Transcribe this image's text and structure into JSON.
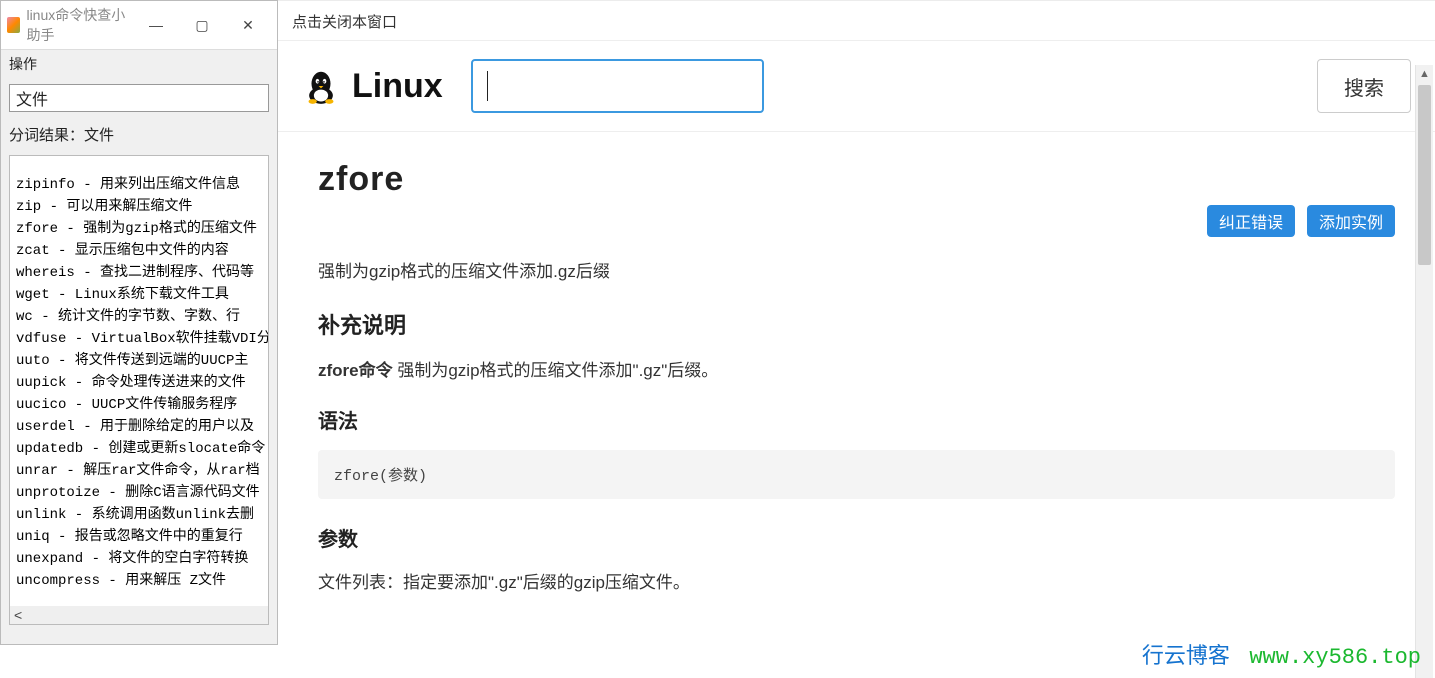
{
  "sidebar": {
    "title": "linux命令快查小助手",
    "menu_label": "操作",
    "search_value": "文件",
    "tokenize_prefix": "分词结果：",
    "tokenize_value": "文件",
    "items": [
      {
        "cmd": "zipinfo",
        "desc": "用来列出压缩文件信息"
      },
      {
        "cmd": "zip",
        "desc": "可以用来解压缩文件"
      },
      {
        "cmd": "zfore",
        "desc": "强制为gzip格式的压缩文件"
      },
      {
        "cmd": "zcat",
        "desc": "显示压缩包中文件的内容"
      },
      {
        "cmd": "whereis",
        "desc": "查找二进制程序、代码等"
      },
      {
        "cmd": "wget",
        "desc": "Linux系统下载文件工具"
      },
      {
        "cmd": "wc",
        "desc": "统计文件的字节数、字数、行"
      },
      {
        "cmd": "vdfuse",
        "desc": "VirtualBox软件挂载VDI分"
      },
      {
        "cmd": "uuto",
        "desc": "将文件传送到远端的UUCP主"
      },
      {
        "cmd": "uupick",
        "desc": "命令处理传送进来的文件"
      },
      {
        "cmd": "uucico",
        "desc": "UUCP文件传输服务程序"
      },
      {
        "cmd": "userdel",
        "desc": "用于删除给定的用户以及"
      },
      {
        "cmd": "updatedb",
        "desc": "创建或更新slocate命令"
      },
      {
        "cmd": "unrar",
        "desc": "解压rar文件命令，从rar档"
      },
      {
        "cmd": "unprotoize",
        "desc": "删除C语言源代码文件"
      },
      {
        "cmd": "unlink",
        "desc": "系统调用函数unlink去删"
      },
      {
        "cmd": "uniq",
        "desc": "报告或忽略文件中的重复行"
      },
      {
        "cmd": "unexpand",
        "desc": "将文件的空白字符转换"
      },
      {
        "cmd": "uncompress",
        "desc": "用来解压 Z文件"
      }
    ]
  },
  "main": {
    "close_hint": "点击关闭本窗口",
    "brand": "Linux",
    "search_placeholder": "",
    "search_button": "搜索",
    "command_title": "zfore",
    "actions": {
      "correct": "纠正错误",
      "example": "添加实例"
    },
    "short_desc": "强制为gzip格式的压缩文件添加.gz后缀",
    "section_supplement": "补充说明",
    "supplement_bold": "zfore命令",
    "supplement_rest": " 强制为gzip格式的压缩文件添加\".gz\"后缀。",
    "section_syntax": "语法",
    "syntax_code": "zfore(参数)",
    "section_params": "参数",
    "params_text": "文件列表：指定要添加\".gz\"后缀的gzip压缩文件。"
  },
  "watermark": {
    "blog": "行云博客",
    "url": "www.xy586.top"
  }
}
